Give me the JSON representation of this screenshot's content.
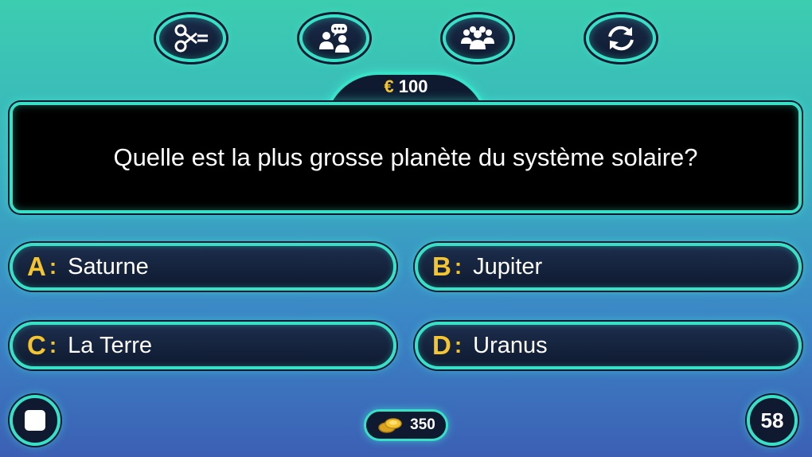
{
  "lifelines": [
    {
      "name": "fifty-fifty",
      "icon": "scissors-icon"
    },
    {
      "name": "ask-friend",
      "icon": "chat-people-icon"
    },
    {
      "name": "ask-audience",
      "icon": "audience-icon"
    },
    {
      "name": "switch-question",
      "icon": "refresh-icon"
    }
  ],
  "prize": {
    "currency": "€",
    "amount": "100"
  },
  "question": {
    "text": "Quelle est la plus grosse planète du système solaire?"
  },
  "answers": [
    {
      "letter": "A",
      "colon": ":",
      "text": "Saturne"
    },
    {
      "letter": "B",
      "colon": ":",
      "text": "Jupiter"
    },
    {
      "letter": "C",
      "colon": ":",
      "text": "La Terre"
    },
    {
      "letter": "D",
      "colon": ":",
      "text": "Uranus"
    }
  ],
  "coins": {
    "count": "350",
    "icon": "coins-icon"
  },
  "timer": {
    "value": "58"
  },
  "stop": {
    "icon": "stop-icon"
  },
  "colors": {
    "accent": "#38e0c8",
    "gold": "#f5c530",
    "panel": "#0f1a30"
  }
}
